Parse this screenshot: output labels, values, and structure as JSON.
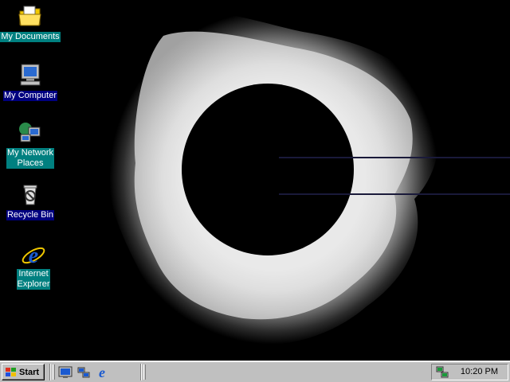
{
  "desktop": {
    "wallpaper": "solar-eclipse",
    "icons": [
      {
        "label": "My Documents",
        "icon": "folder-documents-icon",
        "selected_style": "teal"
      },
      {
        "label": "My Computer",
        "icon": "computer-icon",
        "selected_style": "navy"
      },
      {
        "label": "My Network\nPlaces",
        "icon": "network-places-icon",
        "selected_style": "teal"
      },
      {
        "label": "Recycle Bin",
        "icon": "recycle-bin-icon",
        "selected_style": "navy"
      },
      {
        "label": "Internet\nExplorer",
        "icon": "internet-explorer-icon",
        "selected_style": "teal"
      }
    ]
  },
  "taskbar": {
    "start_label": "Start",
    "quick_launch": [
      "show-desktop-icon",
      "network-icon",
      "internet-explorer-icon"
    ],
    "clock": "10:20 PM"
  },
  "colors": {
    "desktop_bg": "#000000",
    "taskbar_bg": "#c0c0c0",
    "label_teal": "#008080",
    "label_navy": "#000080"
  }
}
